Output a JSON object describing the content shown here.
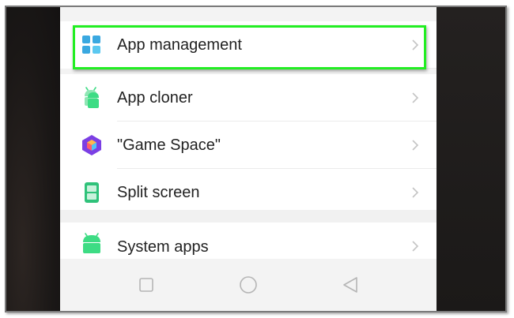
{
  "settings_list": {
    "items": [
      {
        "label": "App management",
        "icon": "app-management-icon",
        "highlighted": true
      },
      {
        "label": "App cloner",
        "icon": "app-cloner-icon"
      },
      {
        "label": "\"Game Space\"",
        "icon": "game-space-icon"
      },
      {
        "label": "Split screen",
        "icon": "split-screen-icon"
      },
      {
        "label": "System apps",
        "icon": "system-apps-icon"
      }
    ]
  },
  "navbar": {
    "buttons": [
      "recents-square-icon",
      "home-circle-icon",
      "back-triangle-icon"
    ]
  },
  "colors": {
    "highlight": "#22ee22",
    "app_management_icon": "#3aa8e0",
    "android_green": "#3ddc84",
    "game_space_purple": "#7b3fe4",
    "split_screen_green": "#2fc27a"
  }
}
